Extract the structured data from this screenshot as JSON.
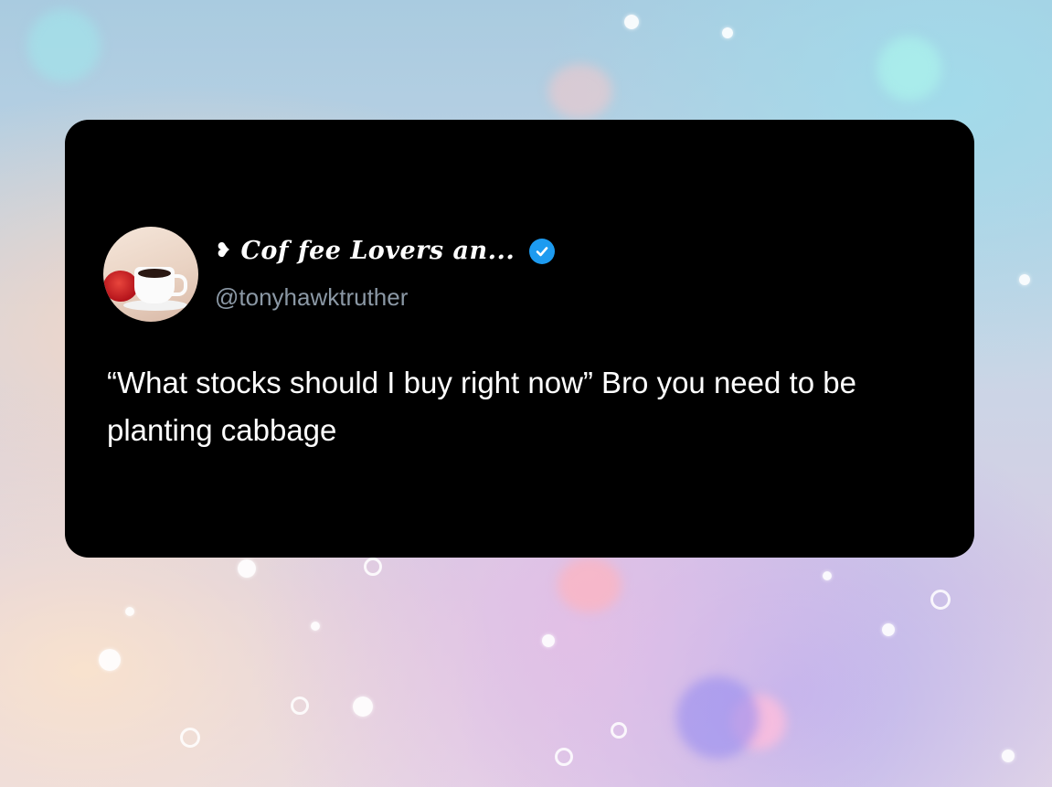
{
  "tweet_card": {
    "display_name": "Cof fee Lovers an...",
    "name_prefix_symbol": "❥",
    "verified_icon": "verified-badge-icon",
    "handle": "@tonyhawktruther",
    "text": "“What stocks should I buy right now” Bro you need to be planting cabbage",
    "avatar_icon": "coffee-cup-avatar"
  },
  "colors": {
    "card_background": "#000000",
    "verified_blue": "#1d9bf0",
    "handle_gray": "#8b98a5",
    "text_white": "#ffffff"
  }
}
